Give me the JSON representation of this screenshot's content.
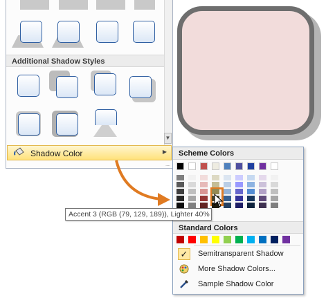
{
  "gallery": {
    "section_label": "Additional Shadow Styles",
    "shadow_color_label": "Shadow Color",
    "grip": "....."
  },
  "color_menu": {
    "scheme_heading": "Scheme Colors",
    "standard_heading": "Standard Colors",
    "theme_top_row": [
      "#000000",
      "#ffffff",
      "#c0504d",
      "#eeece1",
      "#4f81bd",
      "#4f4f9f",
      "#1f3f9f",
      "#7030a0",
      "#ffffff"
    ],
    "theme_columns": [
      [
        "#7f7f7f",
        "#595959",
        "#3f3f3f",
        "#262626",
        "#0d0d0d"
      ],
      [
        "#f2f2f2",
        "#d9d9d9",
        "#bfbfbf",
        "#a6a6a6",
        "#7f7f7f"
      ],
      [
        "#f2dcdb",
        "#e6b9b8",
        "#d99694",
        "#953735",
        "#632523"
      ],
      [
        "#ddd9c3",
        "#c4bd97",
        "#948a54",
        "#4a452a",
        "#1e1c11"
      ],
      [
        "#dbe5f1",
        "#b9cde5",
        "#95b3d7",
        "#366092",
        "#244062"
      ],
      [
        "#ccccff",
        "#9999ff",
        "#6666cc",
        "#333399",
        "#1f1f66"
      ],
      [
        "#c6d9f1",
        "#8db3e2",
        "#548dd4",
        "#17365d",
        "#0f243e"
      ],
      [
        "#e5d9ec",
        "#ccc1da",
        "#b2a1c7",
        "#5f497a",
        "#3f3151"
      ],
      [
        "#f2f2f2",
        "#d9d9d9",
        "#bfbfbf",
        "#a6a6a6",
        "#7f7f7f"
      ]
    ],
    "standard_colors": [
      "#c00000",
      "#ff0000",
      "#ffc000",
      "#ffff00",
      "#92d050",
      "#00b050",
      "#00b0f0",
      "#0070c0",
      "#002060",
      "#7030a0"
    ],
    "items": {
      "semitransparent": "Semitransparent Shadow",
      "more_colors": "More Shadow Colors...",
      "sample_color": "Sample Shadow Color"
    }
  },
  "tooltip": "Accent 3 (RGB (79, 129, 189)), Lighter 40%",
  "colors": {
    "accent_orange": "#e07b22",
    "preview_fill": "#f2dcdb",
    "preview_border": "#6e6e6e",
    "highlight": "#ffe27a"
  },
  "icons": {
    "shadow_color": "paint-bucket-icon",
    "check": "checkmark-icon",
    "more_colors": "palette-icon",
    "sample": "eyedropper-icon",
    "submenu": "chevron-right-icon",
    "scroll": "chevron-down-icon",
    "pointer": "mouse-pointer-icon"
  }
}
